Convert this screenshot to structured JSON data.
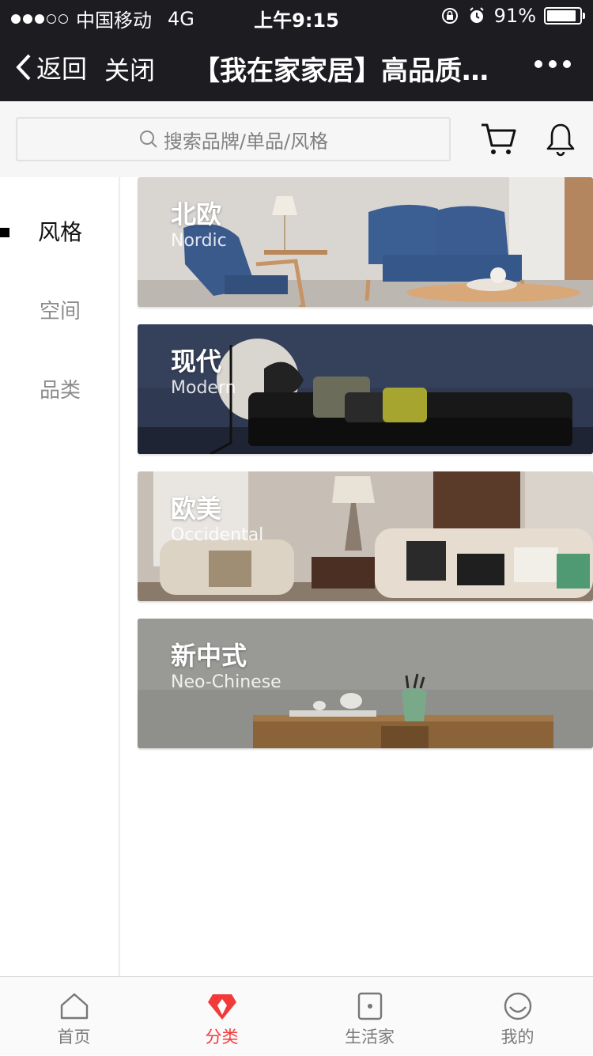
{
  "status_bar": {
    "carrier": "中国移动",
    "network": "4G",
    "time": "上午9:15",
    "battery": "91%",
    "battery_level": 0.91
  },
  "nav": {
    "back_label": "返回",
    "close_label": "关闭",
    "title": "【我在家家居】高品质…"
  },
  "search": {
    "placeholder": "搜索品牌/单品/风格"
  },
  "sidebar": {
    "items": [
      {
        "label": "风格",
        "active": true
      },
      {
        "label": "空间",
        "active": false
      },
      {
        "label": "品类",
        "active": false
      }
    ]
  },
  "cards": [
    {
      "title": "北欧",
      "subtitle": "Nordic"
    },
    {
      "title": "现代",
      "subtitle": "Modern"
    },
    {
      "title": "欧美",
      "subtitle": "Occidental"
    },
    {
      "title": "新中式",
      "subtitle": "Neo-Chinese"
    }
  ],
  "tabbar": {
    "items": [
      {
        "label": "首页",
        "icon": "home-icon",
        "active": false
      },
      {
        "label": "分类",
        "icon": "diamond-icon",
        "active": true
      },
      {
        "label": "生活家",
        "icon": "door-icon",
        "active": false
      },
      {
        "label": "我的",
        "icon": "smile-icon",
        "active": false
      }
    ]
  },
  "colors": {
    "nav_bg": "#1c1c21",
    "accent": "#f23a3a"
  }
}
